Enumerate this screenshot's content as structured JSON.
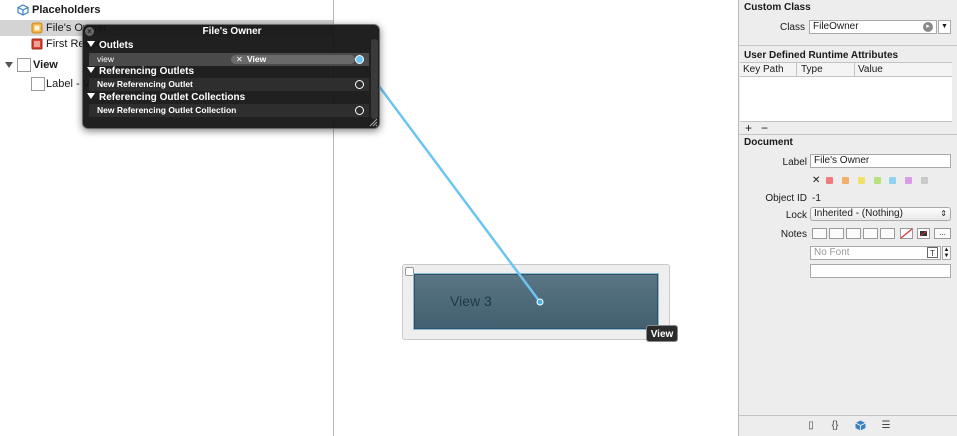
{
  "outline": {
    "placeholders_label": "Placeholders",
    "files_owner_label": "File's Owner",
    "first_responder_label": "First Responder",
    "view_label": "View",
    "label_item": "Label - View 3"
  },
  "canvas": {
    "view_text": "View 3",
    "tooltip": "View"
  },
  "hud": {
    "title": "File's Owner",
    "sections": [
      {
        "title": "Outlets",
        "rows": [
          {
            "name": "view",
            "target": "View"
          }
        ]
      },
      {
        "title": "Referencing Outlets",
        "rows": [
          {
            "name": "New Referencing Outlet"
          }
        ]
      },
      {
        "title": "Referencing Outlet Collections",
        "rows": [
          {
            "name": "New Referencing Outlet Collection"
          }
        ]
      }
    ]
  },
  "inspector": {
    "custom_class": {
      "header": "Custom Class",
      "class_label": "Class",
      "class_value": "FileOwner"
    },
    "runtime_attributes": {
      "header": "User Defined Runtime Attributes",
      "col_keypath": "Key Path",
      "col_type": "Type",
      "col_value": "Value",
      "add": "+",
      "remove": "−"
    },
    "document": {
      "header": "Document",
      "label_label": "Label",
      "label_value": "File's Owner",
      "clear": "✕",
      "colors": [
        "#f07b7b",
        "#f3b06a",
        "#f0e16a",
        "#b9e27c",
        "#8fd3ef",
        "#d79be8",
        "#c9c9c9"
      ],
      "object_id_label": "Object ID",
      "object_id_value": "-1",
      "lock_label": "Lock",
      "lock_value": "Inherited - (Nothing)",
      "notes_label": "Notes",
      "font_placeholder": "No Font",
      "more": "...",
      "font_btn": "T"
    },
    "tabs": [
      "file-icon",
      "braces-icon",
      "cube-icon",
      "list-icon"
    ]
  }
}
